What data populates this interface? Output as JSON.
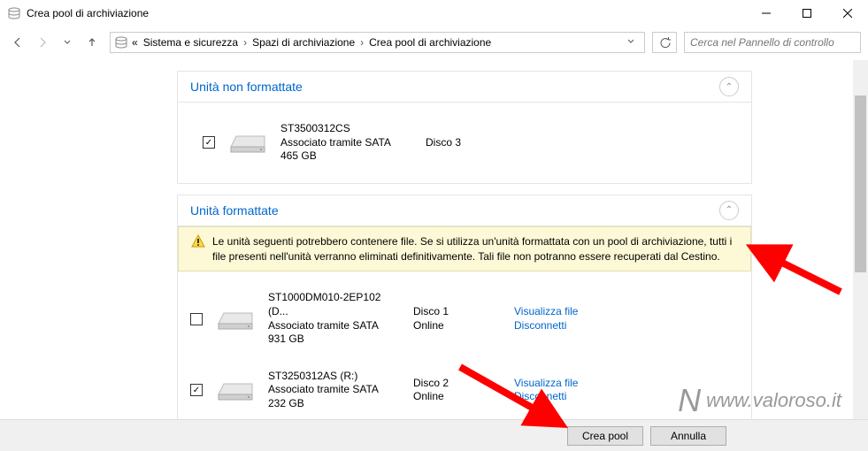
{
  "window": {
    "title": "Crea pool di archiviazione"
  },
  "breadcrumb": {
    "prefix": "«",
    "items": [
      "Sistema e sicurezza",
      "Spazi di archiviazione",
      "Crea pool di archiviazione"
    ]
  },
  "search": {
    "placeholder": "Cerca nel Pannello di controllo"
  },
  "sections": {
    "unformatted": {
      "title": "Unità non formattate",
      "drives": [
        {
          "checked": true,
          "model": "ST3500312CS",
          "conn": "Associato tramite SATA",
          "size": "465 GB",
          "disk": "Disco 3",
          "status": ""
        }
      ]
    },
    "formatted": {
      "title": "Unità formattate",
      "warning": "Le unità seguenti potrebbero contenere file. Se si utilizza un'unità formattata con un pool di archiviazione, tutti i file presenti nell'unità verranno eliminati definitivamente. Tali file non potranno essere recuperati dal Cestino.",
      "drives": [
        {
          "checked": false,
          "model": "ST1000DM010-2EP102 (D...",
          "conn": "Associato tramite SATA",
          "size": "931 GB",
          "disk": "Disco 1",
          "status": "Online"
        },
        {
          "checked": true,
          "model": "ST3250312AS (R:)",
          "conn": "Associato tramite SATA",
          "size": "232 GB",
          "disk": "Disco 2",
          "status": "Online"
        }
      ]
    }
  },
  "links": {
    "view_files": "Visualizza file",
    "disconnect": "Disconnetti"
  },
  "buttons": {
    "create": "Crea pool",
    "cancel": "Annulla"
  },
  "watermark": "www.valoroso.it"
}
